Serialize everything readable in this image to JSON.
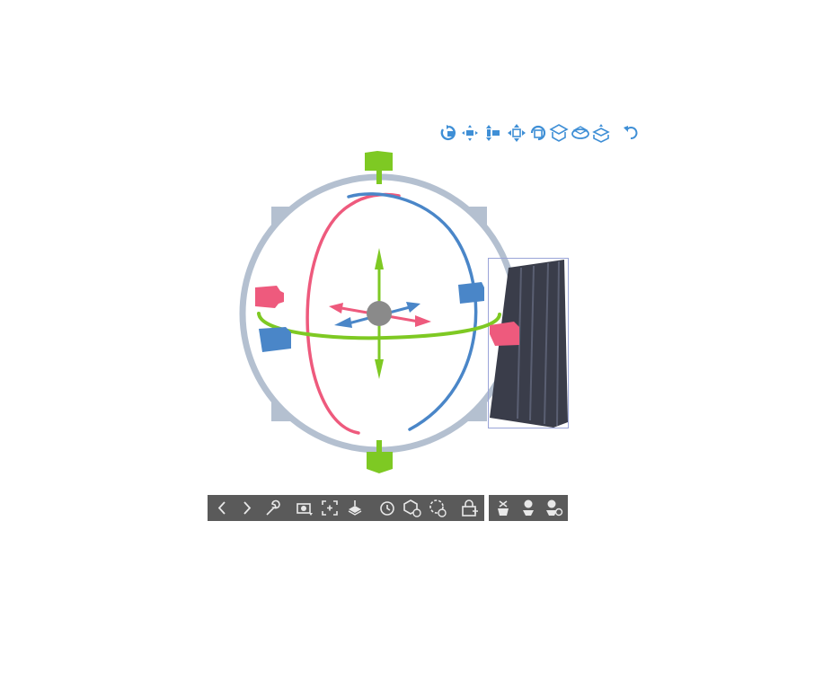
{
  "colors": {
    "x_axis": "#ee5a7d",
    "y_axis": "#7ec923",
    "z_axis": "#4a86c8",
    "ring": "#b4c0d0",
    "toolbar_icon": "#3f8fd6",
    "bottom_bar_bg": "#5a5a5a",
    "bottom_bar_icon": "#e8e8e8",
    "object_dark": "#3a3d4a",
    "selection_box": "#9aa4d8"
  },
  "top_toolbar": {
    "icons": [
      "camera-rotate-icon",
      "camera-pan-icon",
      "camera-dolly-icon",
      "object-move-icon",
      "object-rotate-icon",
      "object-move-plane-icon",
      "object-rotate-plane-icon",
      "object-fit-ground-icon",
      "undo-icon"
    ]
  },
  "bottom_toolbar": {
    "icons": [
      "previous-icon",
      "next-icon",
      "wrench-icon",
      "camera-preset-icon",
      "fit-to-view-icon",
      "ground-place-icon",
      "reset-rotation-icon",
      "reset-object-icon",
      "reset-all-icon",
      "lock-add-icon"
    ],
    "secondary_icons": [
      "pose-hand-icon",
      "pose-body-icon",
      "pose-settings-icon"
    ]
  }
}
